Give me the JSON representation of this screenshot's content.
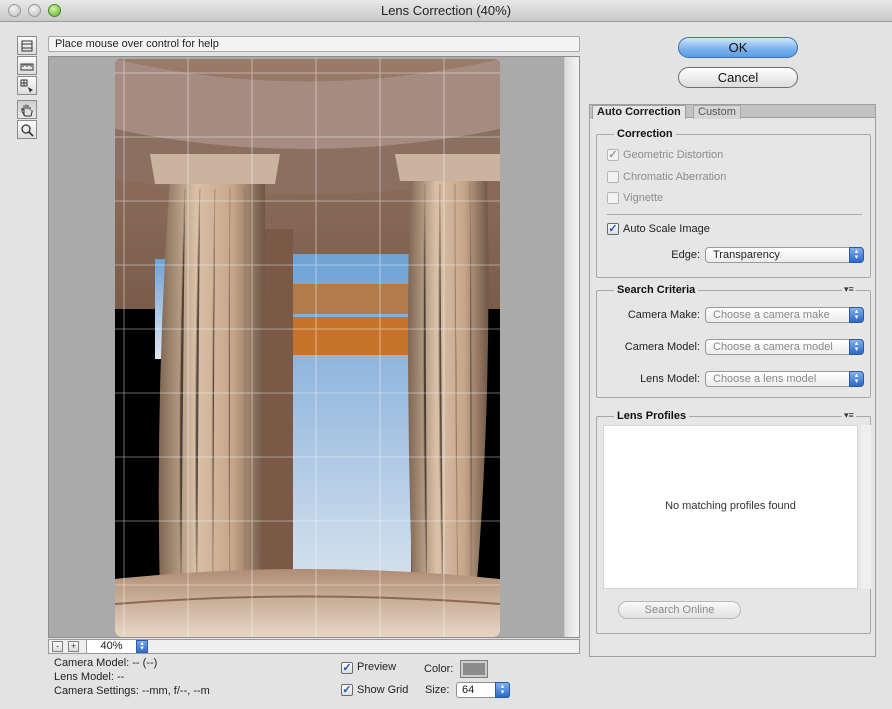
{
  "window": {
    "title": "Lens Correction (40%)"
  },
  "help": {
    "text": "Place mouse over control for help"
  },
  "zoom": {
    "value": "40%",
    "minus": "-",
    "plus": "+"
  },
  "info": {
    "camera_model": "Camera Model: -- (--)",
    "lens_model": "Lens Model: --",
    "camera_settings": "Camera Settings: --mm, f/--, --m"
  },
  "view_options": {
    "preview_label": "Preview",
    "show_grid_label": "Show Grid",
    "color_label": "Color:",
    "size_label": "Size:",
    "size_value": "64",
    "grid_color": "#8c8c8c"
  },
  "buttons": {
    "ok": "OK",
    "cancel": "Cancel"
  },
  "tabs": {
    "auto": "Auto Correction",
    "custom": "Custom"
  },
  "correction": {
    "title": "Correction",
    "geometric": "Geometric Distortion",
    "chromatic": "Chromatic Aberration",
    "vignette": "Vignette",
    "auto_scale": "Auto Scale Image",
    "edge_label": "Edge:",
    "edge_value": "Transparency"
  },
  "search": {
    "title": "Search Criteria",
    "menu": "▾≡",
    "make_label": "Camera Make:",
    "make_value": "Choose a camera make",
    "model_label": "Camera Model:",
    "model_value": "Choose a camera model",
    "lens_label": "Lens Model:",
    "lens_value": "Choose a lens model"
  },
  "profiles": {
    "title": "Lens Profiles",
    "menu": "▾≡",
    "empty": "No matching profiles found",
    "search_online": "Search Online"
  },
  "colors": {
    "accent": "#5a9be4",
    "checkmark": "#1e55b8"
  }
}
